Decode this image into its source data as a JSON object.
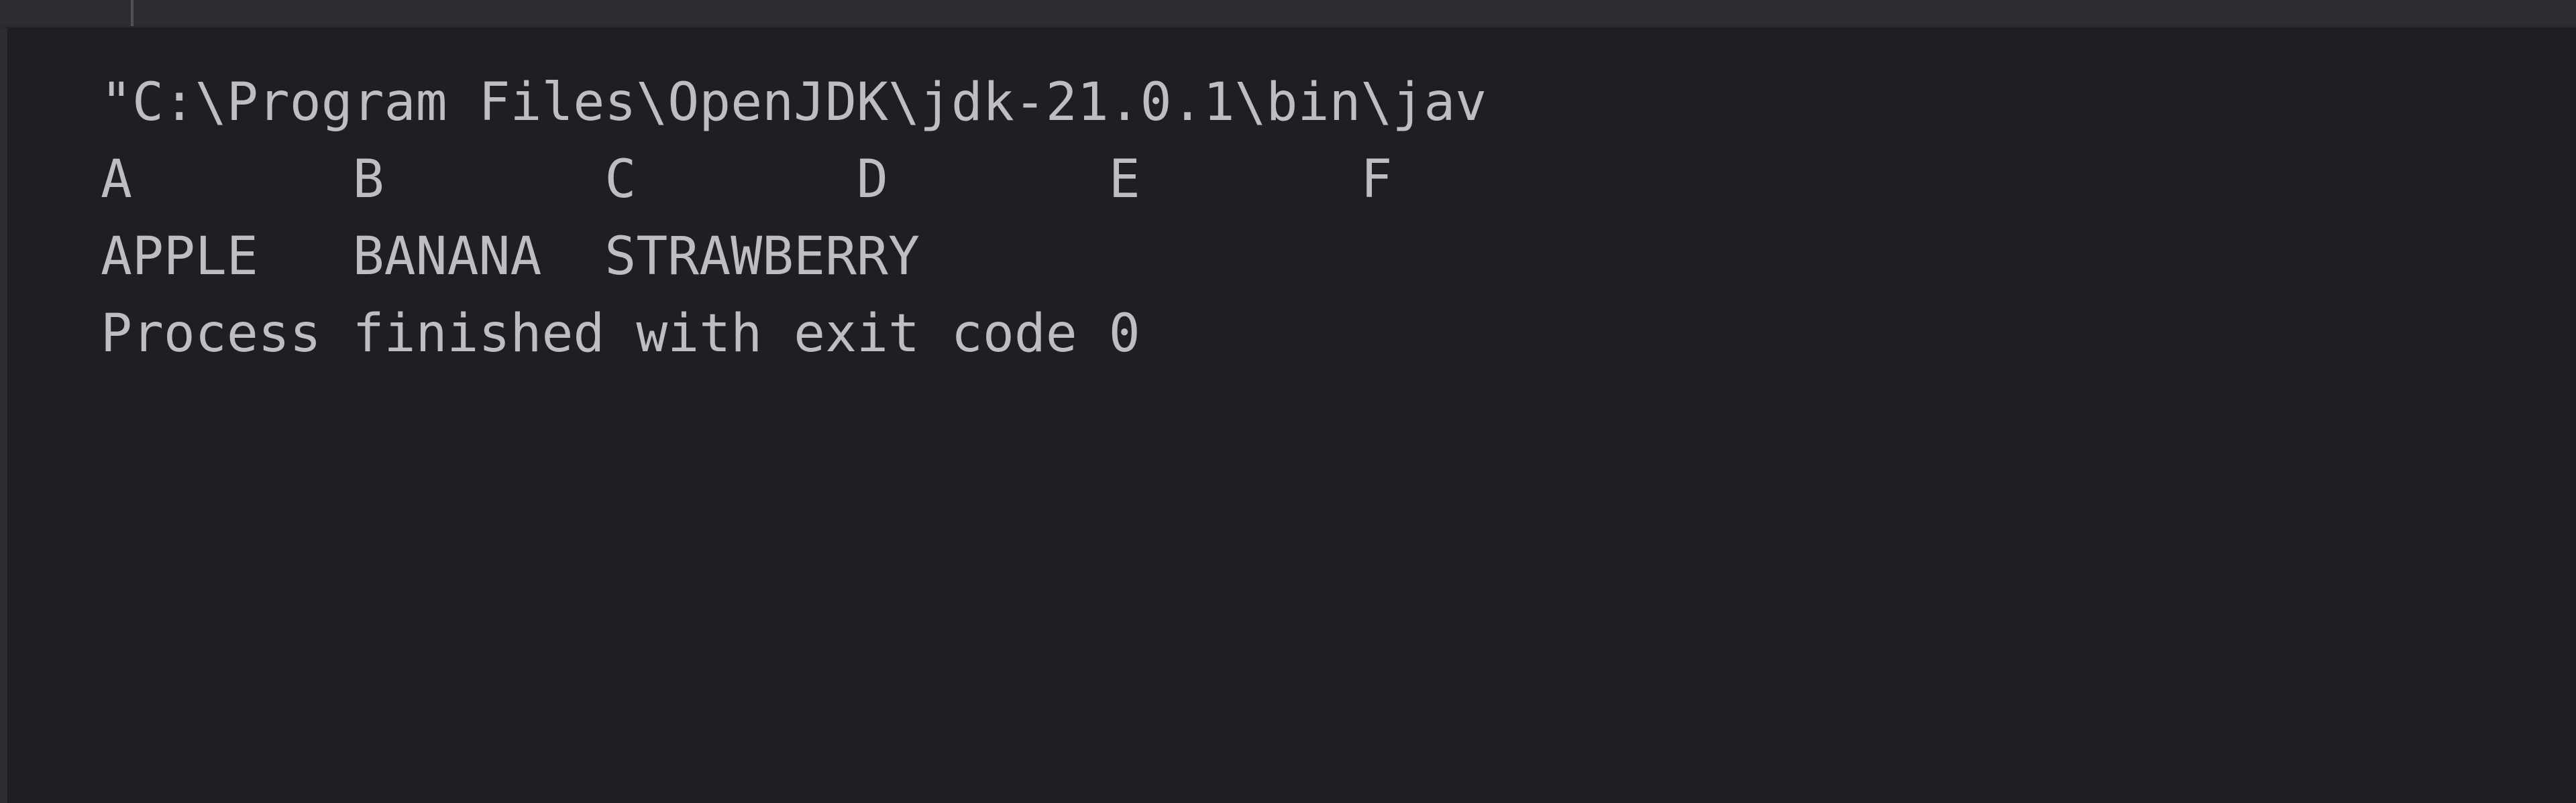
{
  "window": {
    "background_color": "#1e1f22",
    "toolbar_color": "#2b2d30",
    "text_color": "#bcbec4"
  },
  "toolbar": {
    "separator_name": "toolbar-divider"
  },
  "console": {
    "gutter_color": "#2b2d30",
    "lines": [
      {
        "text": "\"C:\\Program Files\\OpenJDK\\jdk-21.0.1\\bin\\jav",
        "clipped": true
      },
      {
        "text": "A\tB\tC\tD\tE\tF",
        "clipped": false
      },
      {
        "text": "APPLE\tBANANA\tSTRAWBERRY",
        "clipped": false
      },
      {
        "text": "Process finished with exit code 0",
        "clipped": false
      }
    ]
  }
}
